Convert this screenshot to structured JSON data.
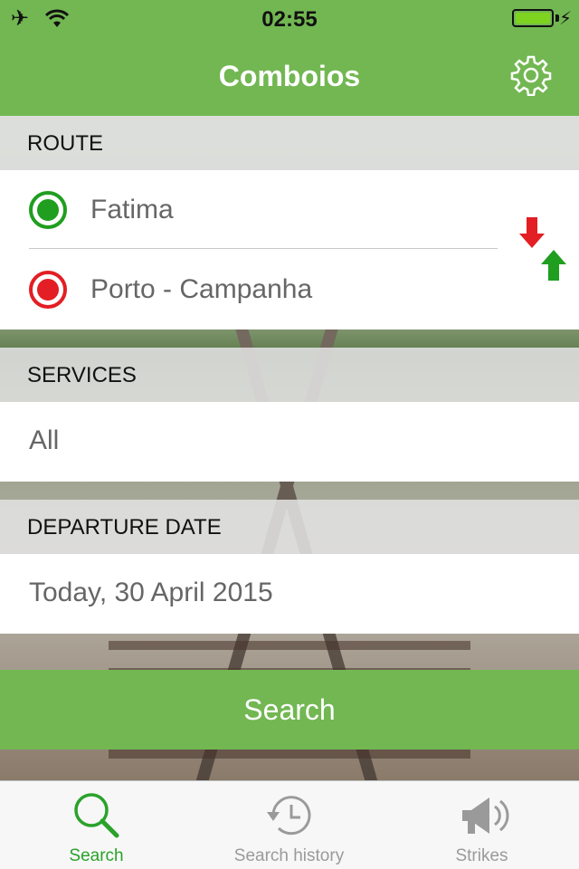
{
  "status_bar": {
    "time": "02:55"
  },
  "nav": {
    "title": "Comboios"
  },
  "route": {
    "header": "ROUTE",
    "origin": "Fatima",
    "destination": "Porto - Campanha"
  },
  "services": {
    "header": "SERVICES",
    "value": "All"
  },
  "departure": {
    "header": "DEPARTURE DATE",
    "value": "Today, 30 April 2015"
  },
  "search_button": {
    "label": "Search"
  },
  "tabs": [
    {
      "label": "Search",
      "icon": "search-icon",
      "active": true
    },
    {
      "label": "Search history",
      "icon": "history-icon",
      "active": false
    },
    {
      "label": "Strikes",
      "icon": "megaphone-icon",
      "active": false
    }
  ],
  "colors": {
    "brand_green": "#72b752",
    "origin_green": "#1f9e1f",
    "destination_red": "#e31e24",
    "active_tab": "#2aa22a",
    "inactive_tab": "#9a9a9a"
  }
}
